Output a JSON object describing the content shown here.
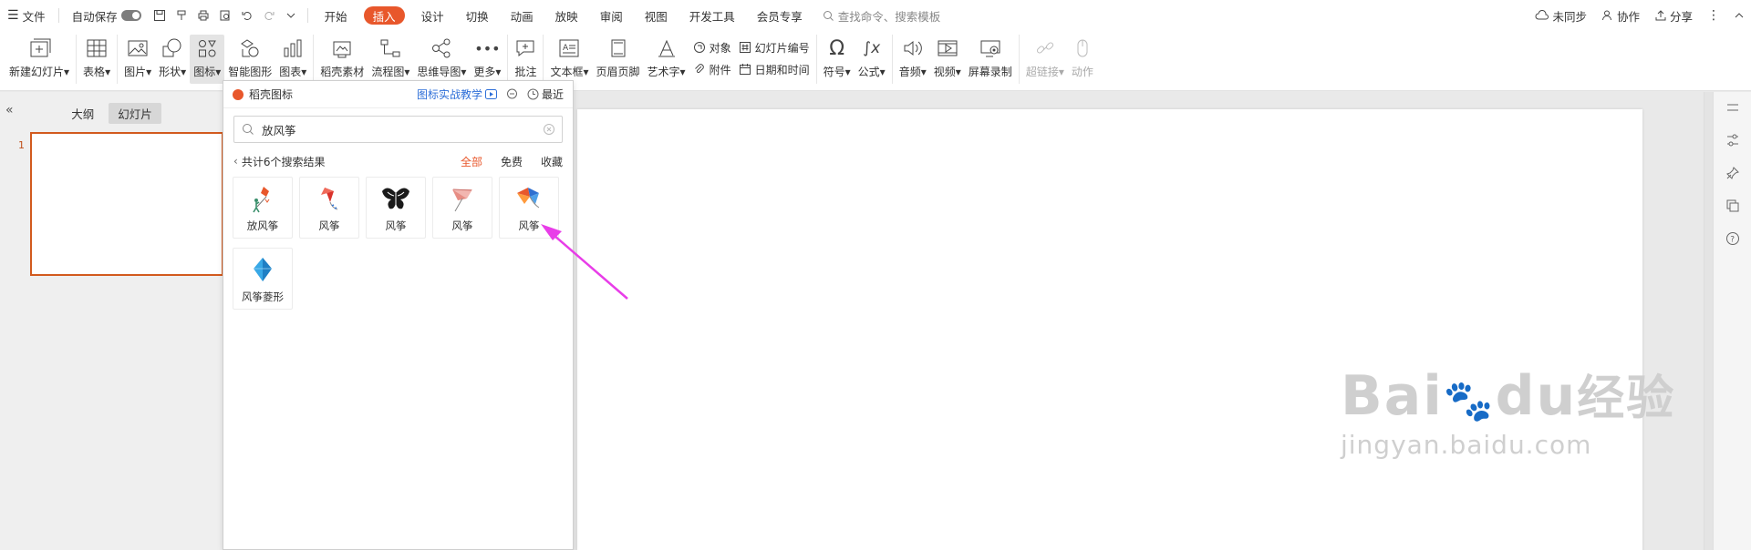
{
  "menubar": {
    "file": "文件",
    "autosave": "自动保存",
    "tabs": [
      {
        "label": "开始",
        "active": false
      },
      {
        "label": "插入",
        "active": true
      },
      {
        "label": "设计",
        "active": false
      },
      {
        "label": "切换",
        "active": false
      },
      {
        "label": "动画",
        "active": false
      },
      {
        "label": "放映",
        "active": false
      },
      {
        "label": "审阅",
        "active": false
      },
      {
        "label": "视图",
        "active": false
      },
      {
        "label": "开发工具",
        "active": false
      },
      {
        "label": "会员专享",
        "active": false
      }
    ],
    "search_placeholder": "查找命令、搜索模板",
    "sync": "未同步",
    "collab": "协作",
    "share": "分享"
  },
  "ribbon": {
    "new_slide": "新建幻灯片",
    "table": "表格",
    "picture": "图片",
    "shape": "形状",
    "icon": "图标",
    "smart_graphic": "智能图形",
    "chart": "图表",
    "material": "稻壳素材",
    "flowchart": "流程图",
    "mindmap": "思维导图",
    "more": "更多",
    "comment": "批注",
    "textbox": "文本框",
    "header_footer": "页眉页脚",
    "wordart": "艺术字",
    "object": "对象",
    "attachment": "附件",
    "slide_number": "幻灯片编号",
    "date_time": "日期和时间",
    "symbol": "符号",
    "formula": "公式",
    "audio": "音频",
    "video": "视频",
    "screen_record": "屏幕录制",
    "hyperlink": "超链接",
    "action": "动作"
  },
  "leftpane": {
    "tab_outline": "大纲",
    "tab_slides": "幻灯片",
    "slide_number": "1"
  },
  "iconpanel": {
    "title": "稻壳图标",
    "tutorial": "图标实战教学",
    "recent": "最近",
    "search_value": "放风筝",
    "result_text": "共计6个搜索结果",
    "filters": [
      "全部",
      "免费",
      "收藏"
    ],
    "results": [
      {
        "label": "放风筝",
        "icon": "person-flying-kite-icon"
      },
      {
        "label": "风筝",
        "icon": "red-diamond-kite-icon"
      },
      {
        "label": "风筝",
        "icon": "black-butterfly-kite-icon"
      },
      {
        "label": "风筝",
        "icon": "pink-kite-icon"
      },
      {
        "label": "风筝",
        "icon": "colorful-kite-icon"
      },
      {
        "label": "风筝菱形",
        "icon": "blue-diamond-kite-icon"
      }
    ]
  },
  "watermark": {
    "brand": "Bai",
    "brand_suffix": "du",
    "cn": "经验",
    "url": "jingyan.baidu.com"
  },
  "colors": {
    "accent": "#e8572b",
    "link": "#2e6fd8",
    "annotation_arrow": "#e83de8"
  }
}
